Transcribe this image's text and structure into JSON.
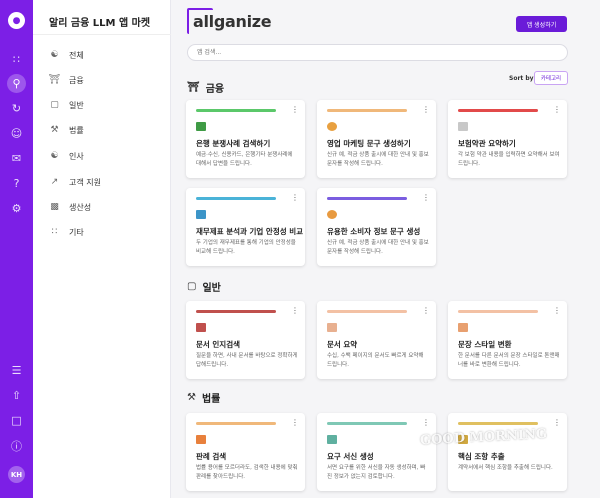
{
  "rail": {
    "logo_icon": "waveform-logo-icon",
    "avatar_initials": "KH",
    "icons": [
      "apps-grid-icon",
      "search-assistant-icon",
      "refresh-icon",
      "person-icon",
      "chat-icon",
      "help-icon",
      "settings-icon",
      "layers-icon",
      "upload-icon",
      "gift-icon",
      "help-circle-icon"
    ]
  },
  "sidebar": {
    "title": "알리 금융 LLM 앱 마켓",
    "items": [
      {
        "label": "전체",
        "icon": "network-icon"
      },
      {
        "label": "금융",
        "icon": "bank-icon"
      },
      {
        "label": "일반",
        "icon": "briefcase-icon"
      },
      {
        "label": "법률",
        "icon": "gavel-icon"
      },
      {
        "label": "인사",
        "icon": "handshake-icon"
      },
      {
        "label": "고객 지원",
        "icon": "trend-chart-icon"
      },
      {
        "label": "생산성",
        "icon": "bar-chart-icon"
      },
      {
        "label": "기타",
        "icon": "dots-grid-icon"
      }
    ]
  },
  "header": {
    "brand": "allganize",
    "create_button": "앱 생성하기",
    "search_placeholder": "앱 검색...",
    "sort_label": "Sort by:",
    "sort_value": "카테고리"
  },
  "sections": [
    {
      "title": "금융",
      "icon": "bank-icon",
      "cards": [
        {
          "title": "은행 분쟁사례 검색하기",
          "desc": "예금·수신, 신용카드, 은행기타 분쟁사례에 대해서 답변을 드립니다.",
          "color": "#5bc86a"
        },
        {
          "title": "영업 마케팅 문구 생성하기",
          "desc": "신규 예, 적금 상품 출시에 대한 안내 및 홍보 문자를 작성해 드립니다.",
          "color": "#f0b87a"
        },
        {
          "title": "보험약관 요약하기",
          "desc": "각 보험 약관 내용을 입력하면 요약해서 보여 드립니다.",
          "color": "#e24a4a"
        },
        {
          "title": "재무제표 분석과 기업 안정성 비교",
          "desc": "두 기업의 재무제표를 통해 기업의 안정성을 비교해 드립니다.",
          "color": "#4ab3d8"
        },
        {
          "title": "유용한 소비자 정보 문구 생성",
          "desc": "신규 예, 적금 상품 출시에 대한 안내 및 홍보 문자를 작성해 드립니다.",
          "color": "#7a5de0"
        }
      ]
    },
    {
      "title": "일반",
      "icon": "briefcase-icon",
      "cards": [
        {
          "title": "문서 인지검색",
          "desc": "질문을 하면, 사내 문서를 바탕으로 정확하게 답해드립니다.",
          "color": "#c0504d"
        },
        {
          "title": "문서 요약",
          "desc": "수십, 수백 페이지의 문서도 빠르게 요약해 드립니다.",
          "color": "#f3c1a4"
        },
        {
          "title": "문장 스타일 변환",
          "desc": "한 문서를 다른 문서의 문장 스타일로 톤앤매너를 바로 변환해 드립니다.",
          "color": "#f3c1a4"
        }
      ]
    },
    {
      "title": "법률",
      "icon": "gavel-icon",
      "cards": [
        {
          "title": "판례 검색",
          "desc": "법률 용어를 모르더라도, 검색한 내용에 맞춰 판례를 찾아드립니다.",
          "color": "#f0b87a"
        },
        {
          "title": "요구 서신 생성",
          "desc": "서면 요구를 위한 서신을 자동 생성하며, 빠진 정보가 없는지 검토합니다.",
          "color": "#7fc8b5"
        },
        {
          "title": "핵심 조항 추출",
          "desc": "계약서에서 핵심 조항을 추출해 드립니다.",
          "color": "#e0c060"
        }
      ]
    }
  ],
  "watermark": "GOOD MORNING"
}
